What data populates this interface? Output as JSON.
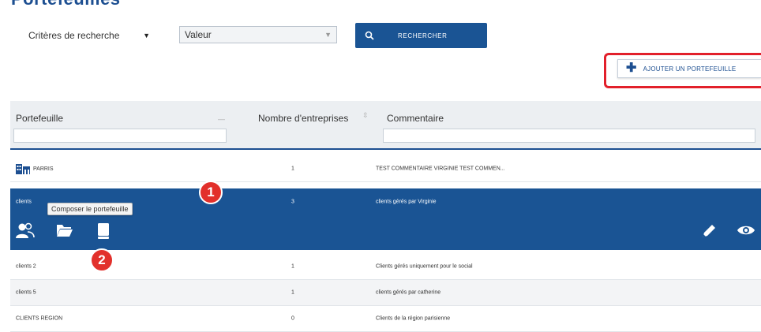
{
  "page_title": "Portefeuilles",
  "search": {
    "criteria_label": "Critères de recherche",
    "value_label": "Valeur",
    "button_label": "RECHERCHER"
  },
  "add_button": {
    "label": "AJOUTER UN PORTEFEUILLE"
  },
  "table": {
    "columns": [
      "Portefeuille",
      "Nombre d'entreprises",
      "Commentaire"
    ],
    "rows": [
      {
        "name": "PARRIS",
        "count": "1",
        "comment": "TEST COMMENTAIRE VIRGINIE TEST COMMEN...",
        "selected": false
      },
      {
        "name": "clients",
        "count": "3",
        "comment": "clients gérés par Virginie",
        "selected": true
      },
      {
        "name": "clients 2",
        "count": "1",
        "comment": "Clients gérés uniquement pour le social",
        "selected": false
      },
      {
        "name": "clients 5",
        "count": "1",
        "comment": "clients gérés par catherine",
        "selected": false
      },
      {
        "name": "CLIENTS REGION",
        "count": "0",
        "comment": "Clients de la région parisienne",
        "selected": false
      }
    ]
  },
  "tooltip": "Composer le portefeuille",
  "steps": [
    "1",
    "2"
  ],
  "colors": {
    "primary": "#1a5494",
    "highlight": "#e2202b",
    "header_bg": "#eceff2"
  },
  "icons": [
    "users-icon",
    "folder-icon",
    "book-icon",
    "pencil-icon",
    "eye-icon",
    "search-icon",
    "plus-icon",
    "building-icon"
  ]
}
